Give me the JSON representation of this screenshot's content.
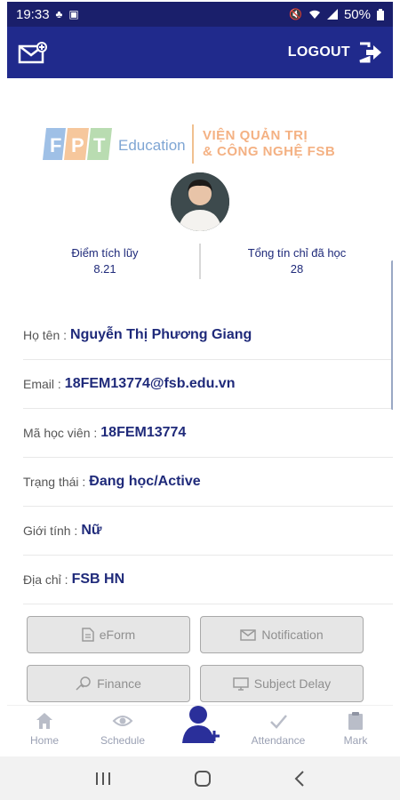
{
  "status_bar": {
    "time": "19:33",
    "battery": "50%"
  },
  "header": {
    "logout_label": "LOGOUT"
  },
  "branding": {
    "fpt": "FPT",
    "education": "Education",
    "fsb_line1": "VIỆN QUẢN TRỊ",
    "fsb_line2": "& CÔNG NGHỆ FSB"
  },
  "stats": [
    {
      "label": "Điểm tích lũy",
      "value": "8.21"
    },
    {
      "label": "Tổng tín chỉ đã học",
      "value": "28"
    }
  ],
  "info": [
    {
      "label": "Họ tên :",
      "value": "Nguyễn Thị Phương Giang"
    },
    {
      "label": "Email :",
      "value": "18FEM13774@fsb.edu.vn"
    },
    {
      "label": "Mã học viên :",
      "value": "18FEM13774"
    },
    {
      "label": "Trạng thái :",
      "value": "Đang học/Active"
    },
    {
      "label": "Giới tính :",
      "value": "Nữ"
    },
    {
      "label": "Địa chỉ :",
      "value": "FSB HN"
    }
  ],
  "buttons": {
    "eform": "eForm",
    "notification": "Notification",
    "finance": "Finance",
    "subject_delay": "Subject Delay"
  },
  "bottom_nav": {
    "home": "Home",
    "schedule": "Schedule",
    "attendance": "Attendance",
    "mark": "Mark"
  },
  "colors": {
    "header": "#202a8c",
    "accent": "#1f2a7a"
  }
}
